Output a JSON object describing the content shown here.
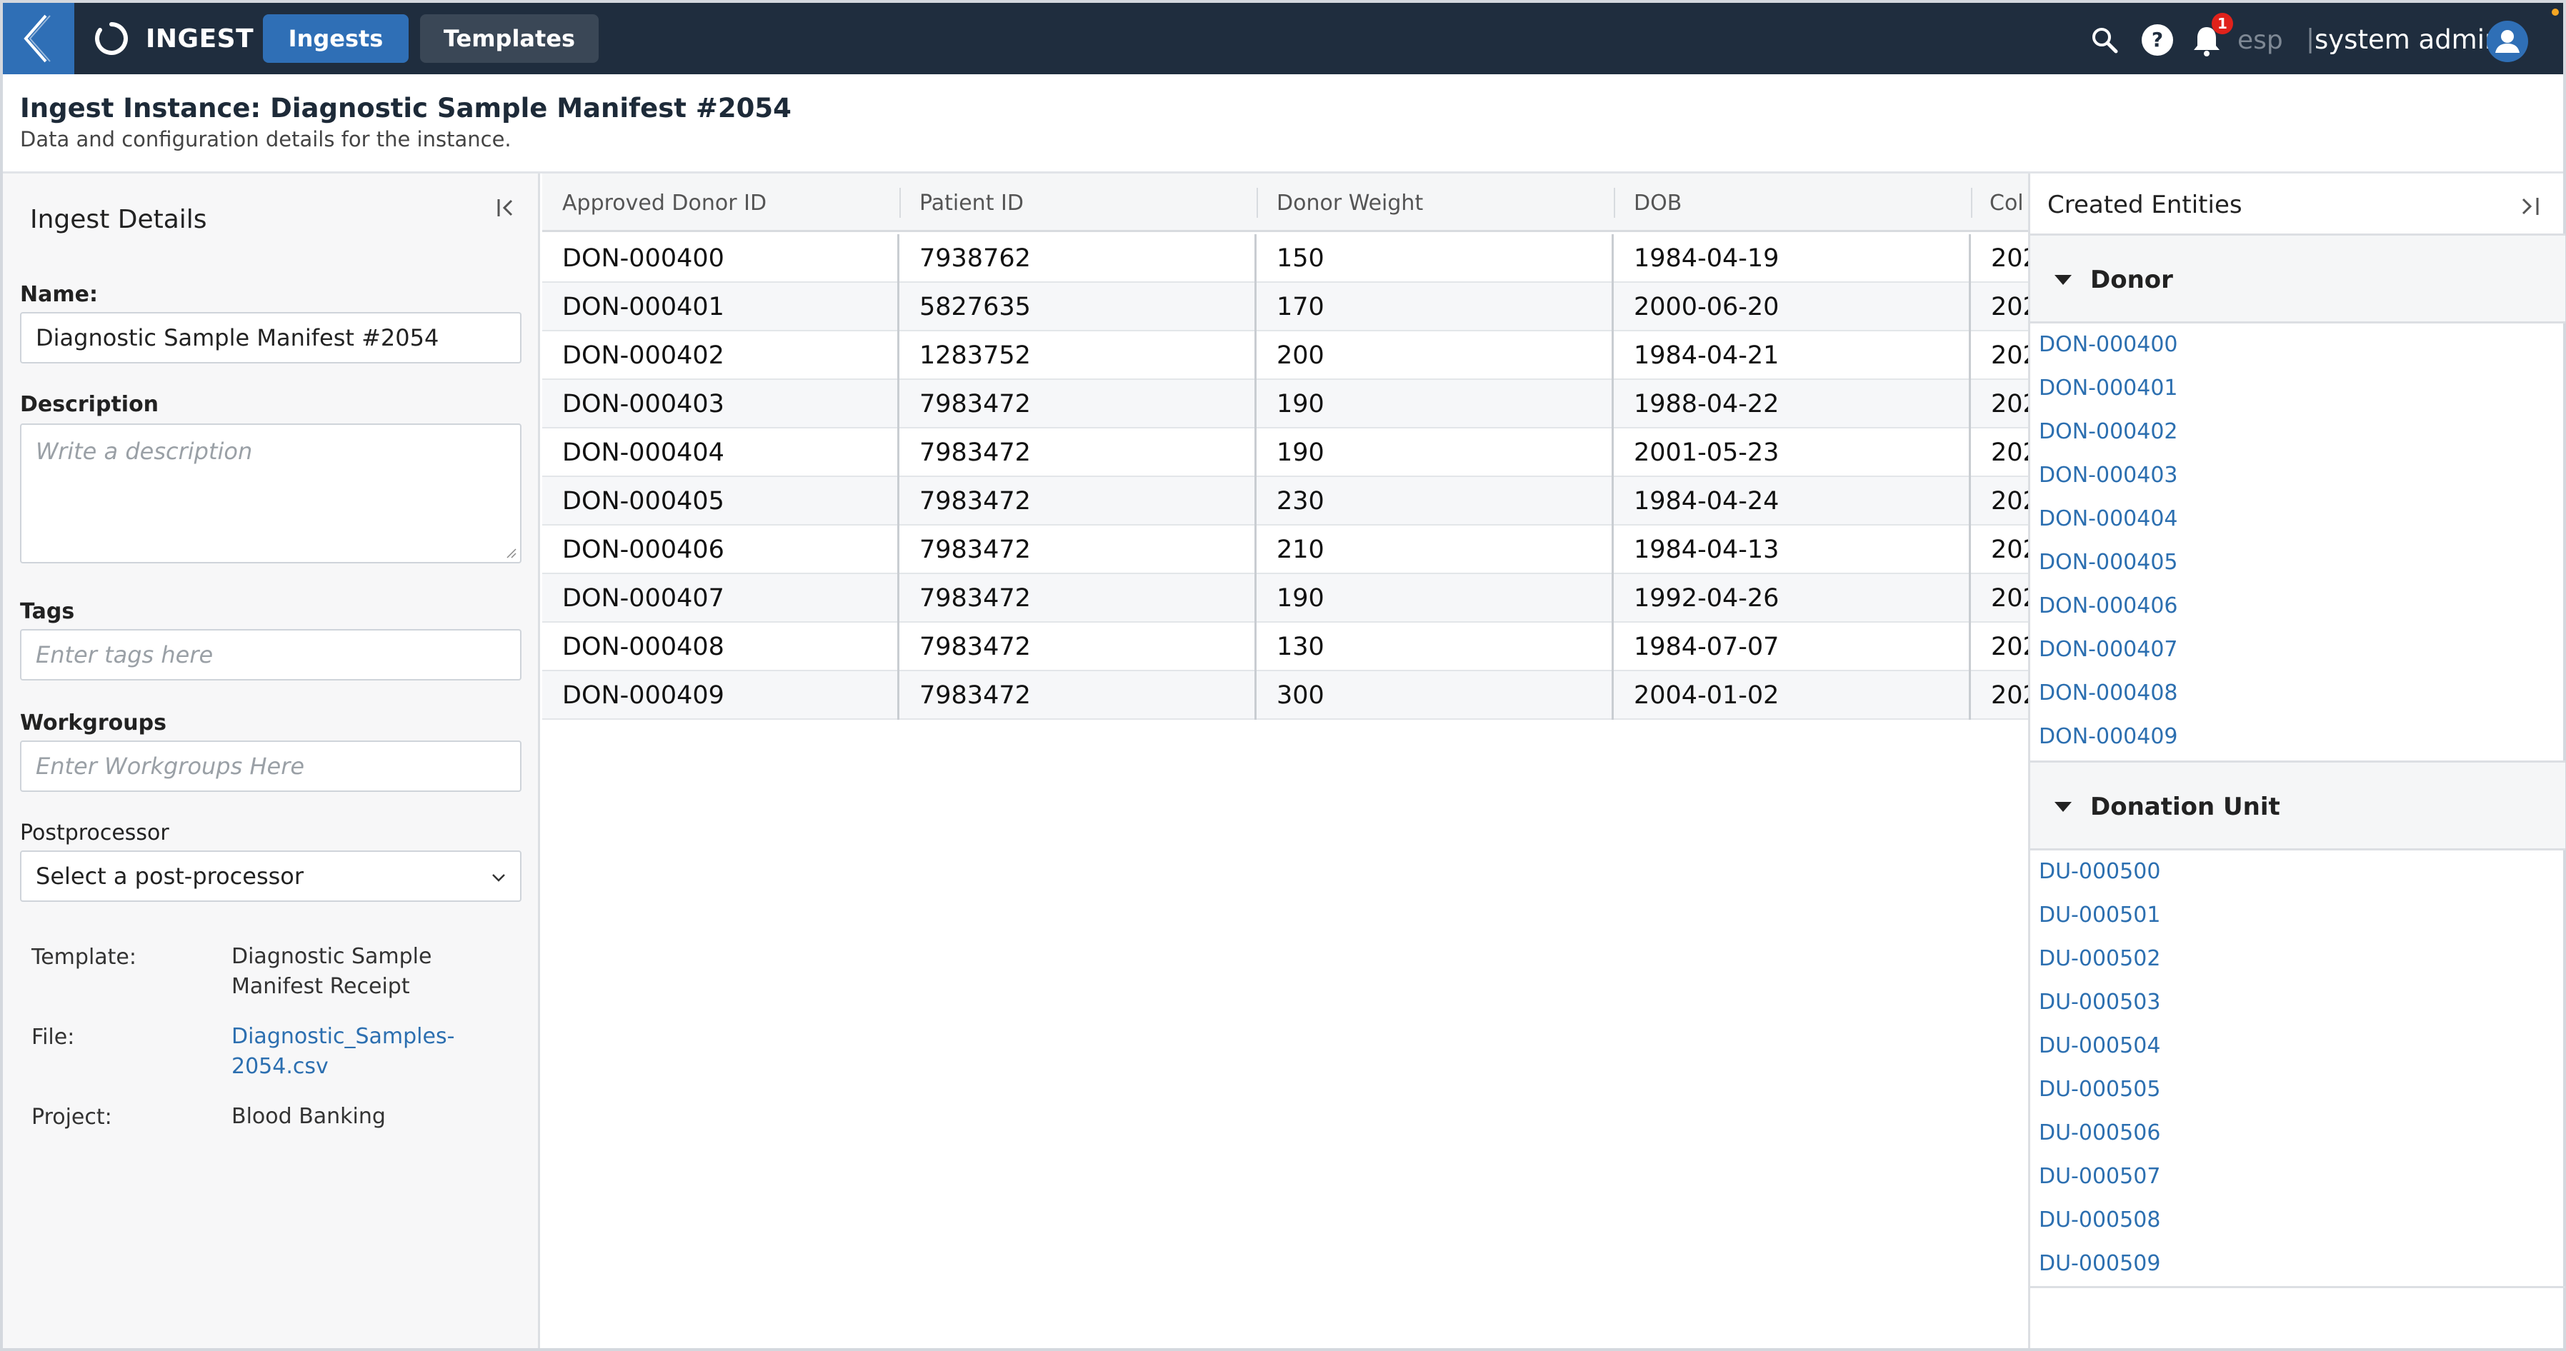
{
  "header": {
    "brand": "INGEST",
    "tabs": [
      {
        "label": "Ingests",
        "active": true
      },
      {
        "label": "Templates",
        "active": false
      }
    ],
    "notification_count": "1",
    "language": "esp",
    "separator": "|",
    "user_name": "system admin"
  },
  "page": {
    "title": "Ingest Instance: Diagnostic Sample Manifest #2054",
    "subtitle": "Data and configuration details for the instance."
  },
  "details": {
    "heading": "Ingest Details",
    "name_label": "Name:",
    "name_value": "Diagnostic Sample Manifest #2054",
    "description_label": "Description",
    "description_placeholder": "Write a description",
    "tags_label": "Tags",
    "tags_placeholder": "Enter tags here",
    "workgroups_label": "Workgroups",
    "workgroups_placeholder": "Enter Workgroups Here",
    "postprocessor_label": "Postprocessor",
    "postprocessor_value": "Select a post-processor",
    "template_label": "Template:",
    "template_value": "Diagnostic Sample Manifest Receipt",
    "file_label": "File:",
    "file_value": "Diagnostic_Samples-2054.csv",
    "project_label": "Project:",
    "project_value": "Blood Banking"
  },
  "table": {
    "columns": [
      "Approved Donor ID",
      "Patient ID",
      "Donor Weight",
      "DOB",
      "Col"
    ],
    "rows": [
      [
        "DON-000400",
        "7938762",
        "150",
        "1984-04-19",
        "202"
      ],
      [
        "DON-000401",
        "5827635",
        "170",
        "2000-06-20",
        "202"
      ],
      [
        "DON-000402",
        "1283752",
        "200",
        "1984-04-21",
        "202"
      ],
      [
        "DON-000403",
        "7983472",
        "190",
        "1988-04-22",
        "202"
      ],
      [
        "DON-000404",
        "7983472",
        "190",
        "2001-05-23",
        "202"
      ],
      [
        "DON-000405",
        "7983472",
        "230",
        "1984-04-24",
        "202"
      ],
      [
        "DON-000406",
        "7983472",
        "210",
        "1984-04-13",
        "202"
      ],
      [
        "DON-000407",
        "7983472",
        "190",
        "1992-04-26",
        "202"
      ],
      [
        "DON-000408",
        "7983472",
        "130",
        "1984-07-07",
        "202"
      ],
      [
        "DON-000409",
        "7983472",
        "300",
        "2004-01-02",
        "202"
      ]
    ]
  },
  "entities": {
    "heading": "Created Entities",
    "sections": [
      {
        "title": "Donor",
        "items": [
          "DON-000400",
          "DON-000401",
          "DON-000402",
          "DON-000403",
          "DON-000404",
          "DON-000405",
          "DON-000406",
          "DON-000407",
          "DON-000408",
          "DON-000409"
        ]
      },
      {
        "title": "Donation Unit",
        "items": [
          "DU-000500",
          "DU-000501",
          "DU-000502",
          "DU-000503",
          "DU-000504",
          "DU-000505",
          "DU-000506",
          "DU-000507",
          "DU-000508",
          "DU-000509"
        ]
      }
    ]
  },
  "colors": {
    "topbar": "#1f2d3e",
    "accent": "#2f6fb6",
    "link": "#2c6fb0",
    "badge": "#e0221b"
  }
}
